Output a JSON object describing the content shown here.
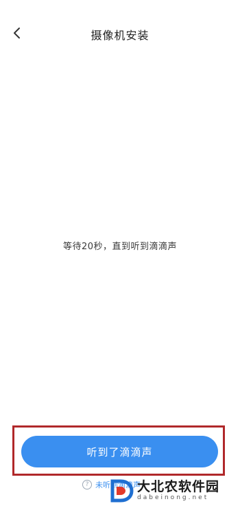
{
  "header": {
    "back_icon": "chevron-left-icon",
    "title": "摄像机安装"
  },
  "main": {
    "instruction": "等待20秒，直到听到滴滴声"
  },
  "footer": {
    "primary_button_label": "听到了滴滴声",
    "help_icon": "question-circle-icon",
    "help_glyph": "?",
    "help_text": "未听到滴滴声"
  },
  "watermark": {
    "name": "大北农软件园",
    "domain": "dabeinong.net"
  },
  "colors": {
    "accent": "#3a8ff0",
    "highlight_border": "#b0282a",
    "background": "#ffffff"
  }
}
